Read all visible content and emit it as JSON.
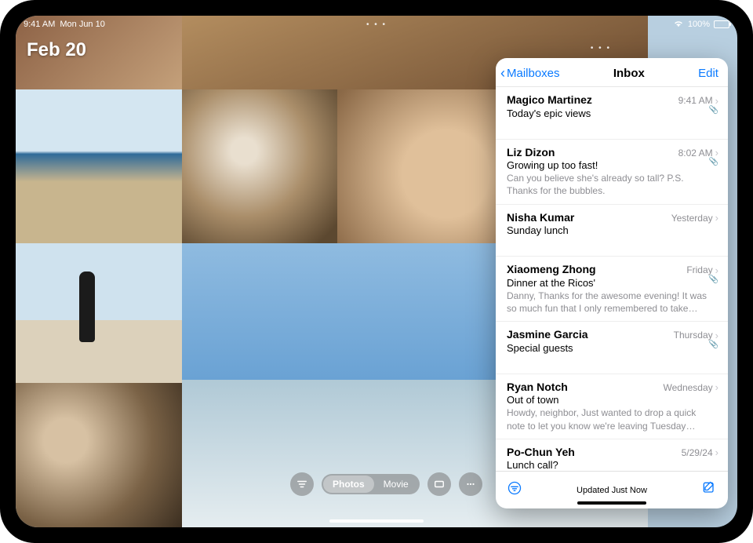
{
  "statusbar": {
    "time": "9:41 AM",
    "date": "Mon Jun 10",
    "battery": "100%"
  },
  "photos": {
    "date_label": "Feb 20",
    "seg_photos": "Photos",
    "seg_movie": "Movie",
    "mt_dots": "• • •"
  },
  "mail": {
    "back_label": "Mailboxes",
    "title": "Inbox",
    "edit": "Edit",
    "updated": "Updated Just Now",
    "items": [
      {
        "sender": "Magico Martinez",
        "time": "9:41 AM",
        "subject": "Today's epic views",
        "preview": "",
        "attach": true
      },
      {
        "sender": "Liz Dizon",
        "time": "8:02 AM",
        "subject": "Growing up too fast!",
        "preview": "Can you believe she's already so tall? P.S. Thanks for the bubbles.",
        "attach": true
      },
      {
        "sender": "Nisha Kumar",
        "time": "Yesterday",
        "subject": "Sunday lunch",
        "preview": "",
        "attach": false
      },
      {
        "sender": "Xiaomeng Zhong",
        "time": "Friday",
        "subject": "Dinner at the Ricos'",
        "preview": "Danny, Thanks for the awesome evening! It was so much fun that I only remembered to take on…",
        "attach": true
      },
      {
        "sender": "Jasmine Garcia",
        "time": "Thursday",
        "subject": "Special guests",
        "preview": "",
        "attach": true
      },
      {
        "sender": "Ryan Notch",
        "time": "Wednesday",
        "subject": "Out of town",
        "preview": "Howdy, neighbor, Just wanted to drop a quick note to let you know we're leaving Tuesday an…",
        "attach": false
      },
      {
        "sender": "Po-Chun Yeh",
        "time": "5/29/24",
        "subject": "Lunch call?",
        "preview": "",
        "attach": false
      }
    ]
  }
}
